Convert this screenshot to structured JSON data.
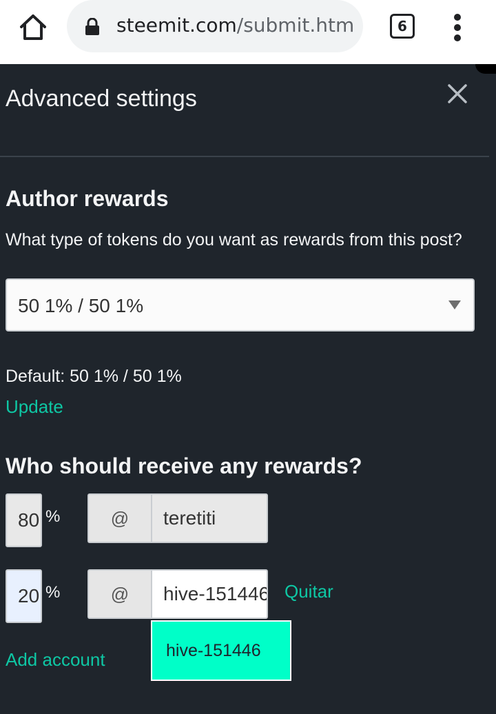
{
  "browser": {
    "url_host": "steemit.com",
    "url_path": "/submit.htm",
    "tab_count": "6"
  },
  "panel": {
    "title": "Advanced settings",
    "author_rewards": {
      "heading": "Author rewards",
      "question": "What type of tokens do you want as rewards from this post?",
      "selected": "50 1% / 50 1%",
      "default_text": "Default: 50 1% / 50 1%",
      "update_label": "Update"
    },
    "beneficiaries": {
      "heading": "Who should receive any rewards?",
      "rows": [
        {
          "percent": "80",
          "at": "@",
          "account": "teretiti"
        },
        {
          "percent": "20",
          "at": "@",
          "account": "hive-151446",
          "remove_label": "Quitar"
        }
      ],
      "suggestion": "hive-151446",
      "add_account_label": "Add account"
    }
  },
  "colors": {
    "background": "#1f252c",
    "accent": "#0ec7a4",
    "suggestion_bg": "#00ffc8"
  }
}
